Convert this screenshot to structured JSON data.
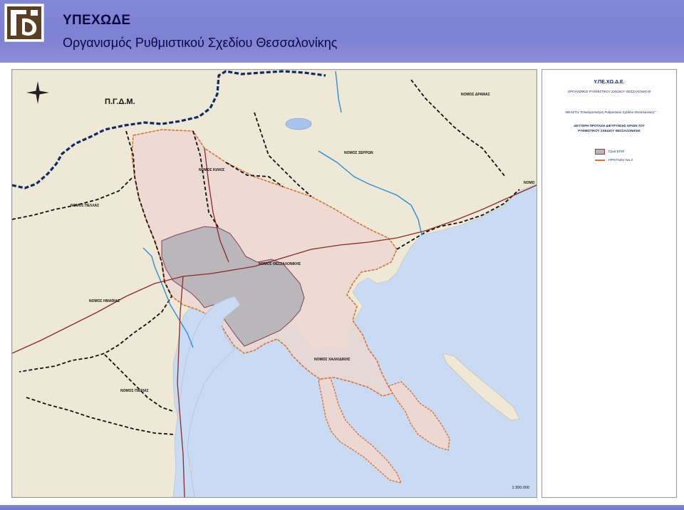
{
  "header": {
    "title": "ΥΠΕΧΩΔΕ",
    "subtitle": "Οργανισμός Ρυθμιστικού Σχεδίου Θεσσαλονίκης"
  },
  "map": {
    "country_label": "Π.Γ.Δ.Μ.",
    "prefectures": {
      "drama": "ΝΟΜΟΣ ΔΡΑΜΑΣ",
      "serres": "ΝΟΜΟΣ ΣΕΡΡΩΝ",
      "kilkis": "ΝΟΜΟΣ ΚΙΛΚΙΣ",
      "pella": "ΝΟΜΟΣ ΠΕΛΛΑΣ",
      "thessaloniki": "ΝΟΜΟΣ ΘΕΣΣΑΛΟΝΙΚΗΣ",
      "imathia": "ΝΟΜΟΣ ΗΜΑΘΙΑΣ",
      "chalkidiki": "ΝΟΜΟΣ ΧΑΛΚΙΔΙΚΗΣ",
      "pieria": "ΝΟΜΟΣ ΠΙΕΡΙΑΣ",
      "kavala_partial": "ΝΟΜΟ"
    },
    "scale": "1:300.000",
    "colors": {
      "sea": "#c9daf3",
      "land": "#eee9d6",
      "study_area": "#b7b5b8",
      "proposal_area": "#ecd7d2",
      "proposal_border": "#d8733a",
      "national_border": "#0f2a66",
      "prefecture_border": "#111111",
      "rivers": "#2c8fd8",
      "roads": "#8a2a2a"
    }
  },
  "legend": {
    "title": "Υ.ΠΕ.ΧΩ.Δ.Ε.",
    "organization": "ΟΡΓΑΝΙΣΜΟΣ ΡΥΘΜΙΣΤΙΚΟΥ ΣΧΕΔΙΟΥ ΘΕΣΣΑΛΟΝΙΚΗΣ",
    "study": "ΜΕΛΕΤΗ \"Επικαιροποίηση Ρυθμιστικού Σχεδίου Θεσσαλονίκης\"",
    "proposal_line1": "ΔΕΥΤΕΡΗ ΠΡΟΤΑΣΗ ΔΙΕΥΡΥΝΣΗΣ ΟΡΙΩΝ ΤΟΥ",
    "proposal_line2": "ΡΥΘΜΙΣΤΙΚΟΥ ΣΧΕΔΙΟΥ ΘΕΣΣΑΛΟΝΙΚΗΣ",
    "items": [
      {
        "label": "Όρια ΕΠΘ"
      },
      {
        "label": "ΠΡΟΤΑΣΗ Νο 2"
      }
    ]
  }
}
